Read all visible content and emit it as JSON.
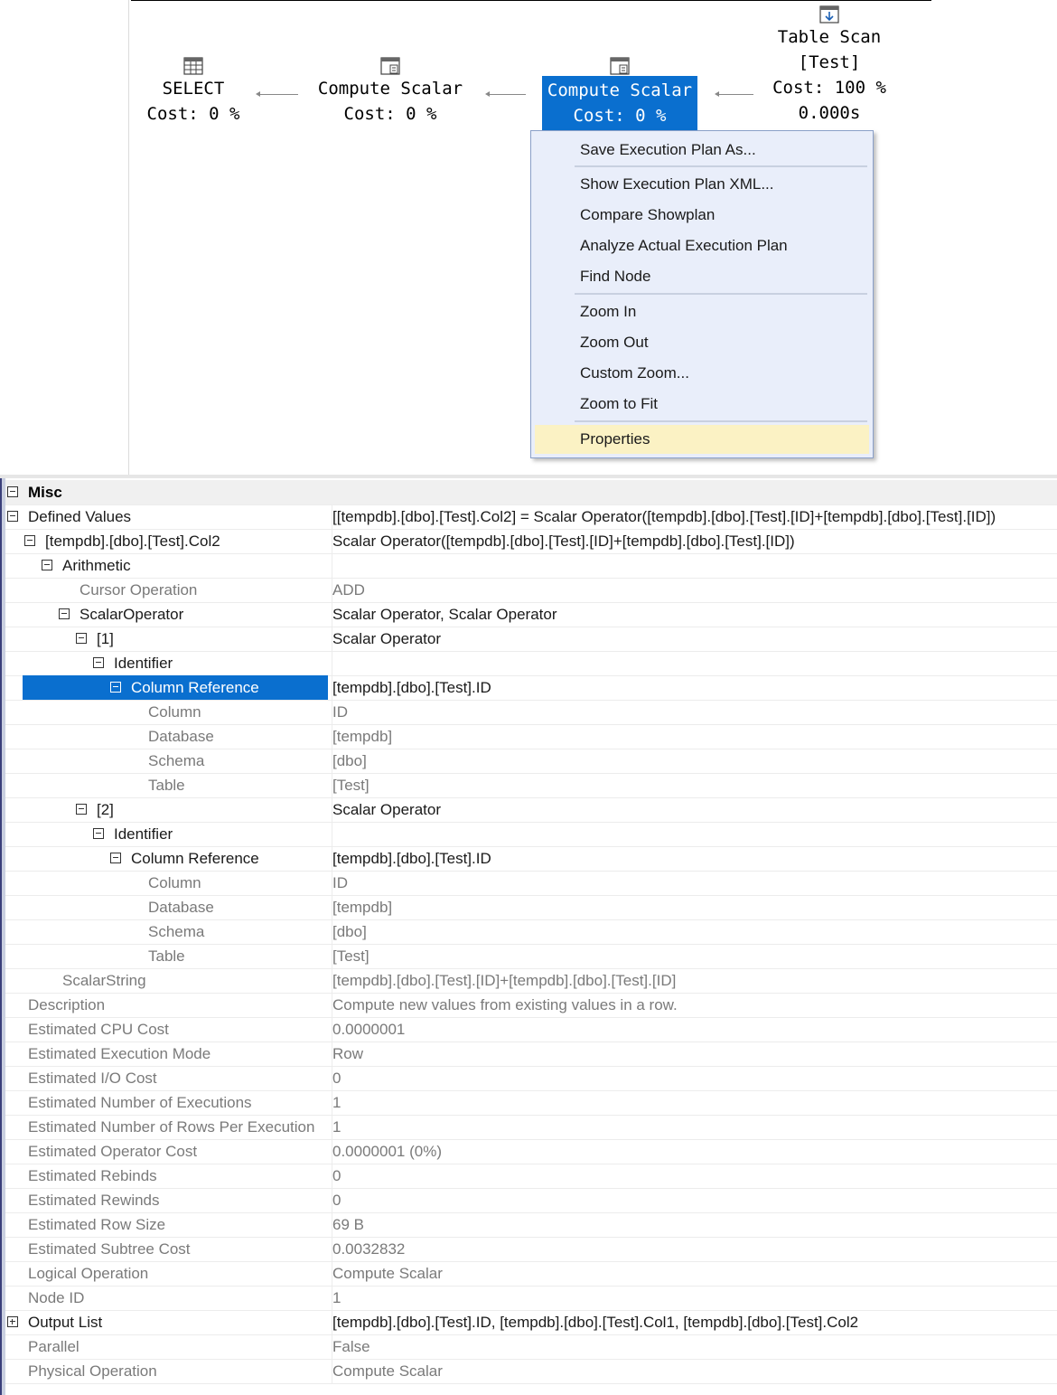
{
  "plan": {
    "nodes": [
      {
        "line1": "SELECT",
        "line2": "Cost: 0 %",
        "icon": "select-grid-icon"
      },
      {
        "line1": "Compute Scalar",
        "line2": "Cost: 0 %",
        "icon": "compute-scalar-icon"
      },
      {
        "line1": "Compute Scalar",
        "line2": "Cost: 0 %",
        "icon": "compute-scalar-icon"
      },
      {
        "line0": "Table Scan",
        "line1": "[Test]",
        "line2": "Cost: 100 %",
        "line3": "0.000s",
        "icon": "table-scan-icon"
      }
    ],
    "selected_color": "#0a6fcf"
  },
  "context_menu": {
    "items": [
      "Save Execution Plan As...",
      "Show Execution Plan XML...",
      "Compare Showplan",
      "Analyze Actual Execution Plan",
      "Find Node",
      "Zoom In",
      "Zoom Out",
      "Custom Zoom...",
      "Zoom to Fit",
      "Properties"
    ],
    "hover_color": "#fbf2c4"
  },
  "properties": {
    "rows": [
      {
        "name": "Misc",
        "value": ""
      },
      {
        "name": "Defined Values",
        "value": "[[tempdb].[dbo].[Test].Col2] = Scalar Operator([tempdb].[dbo].[Test].[ID]+[tempdb].[dbo].[Test].[ID])"
      },
      {
        "name": "[tempdb].[dbo].[Test].Col2",
        "value": "Scalar Operator([tempdb].[dbo].[Test].[ID]+[tempdb].[dbo].[Test].[ID])"
      },
      {
        "name": "Arithmetic",
        "value": ""
      },
      {
        "name": "Cursor Operation",
        "value": "ADD"
      },
      {
        "name": "ScalarOperator",
        "value": "Scalar Operator, Scalar Operator"
      },
      {
        "name": "[1]",
        "value": "Scalar Operator"
      },
      {
        "name": "Identifier",
        "value": ""
      },
      {
        "name": "Column Reference",
        "value": "[tempdb].[dbo].[Test].ID"
      },
      {
        "name": "Column",
        "value": "ID"
      },
      {
        "name": "Database",
        "value": "[tempdb]"
      },
      {
        "name": "Schema",
        "value": "[dbo]"
      },
      {
        "name": "Table",
        "value": "[Test]"
      },
      {
        "name": "[2]",
        "value": "Scalar Operator"
      },
      {
        "name": "Identifier",
        "value": ""
      },
      {
        "name": "Column Reference",
        "value": "[tempdb].[dbo].[Test].ID"
      },
      {
        "name": "Column",
        "value": "ID"
      },
      {
        "name": "Database",
        "value": "[tempdb]"
      },
      {
        "name": "Schema",
        "value": "[dbo]"
      },
      {
        "name": "Table",
        "value": "[Test]"
      },
      {
        "name": "ScalarString",
        "value": "[tempdb].[dbo].[Test].[ID]+[tempdb].[dbo].[Test].[ID]"
      },
      {
        "name": "Description",
        "value": "Compute new values from existing values in a row."
      },
      {
        "name": "Estimated CPU Cost",
        "value": "0.0000001"
      },
      {
        "name": "Estimated Execution Mode",
        "value": "Row"
      },
      {
        "name": "Estimated I/O Cost",
        "value": "0"
      },
      {
        "name": "Estimated Number of Executions",
        "value": "1"
      },
      {
        "name": "Estimated Number of Rows Per Execution",
        "value": "1"
      },
      {
        "name": "Estimated Operator Cost",
        "value": "0.0000001 (0%)"
      },
      {
        "name": "Estimated Rebinds",
        "value": "0"
      },
      {
        "name": "Estimated Rewinds",
        "value": "0"
      },
      {
        "name": "Estimated Row Size",
        "value": "69 B"
      },
      {
        "name": "Estimated Subtree Cost",
        "value": "0.0032832"
      },
      {
        "name": "Logical Operation",
        "value": "Compute Scalar"
      },
      {
        "name": "Node ID",
        "value": "1"
      },
      {
        "name": "Output List",
        "value": "[tempdb].[dbo].[Test].ID, [tempdb].[dbo].[Test].Col1, [tempdb].[dbo].[Test].Col2"
      },
      {
        "name": "Parallel",
        "value": "False"
      },
      {
        "name": "Physical Operation",
        "value": "Compute Scalar"
      }
    ]
  }
}
